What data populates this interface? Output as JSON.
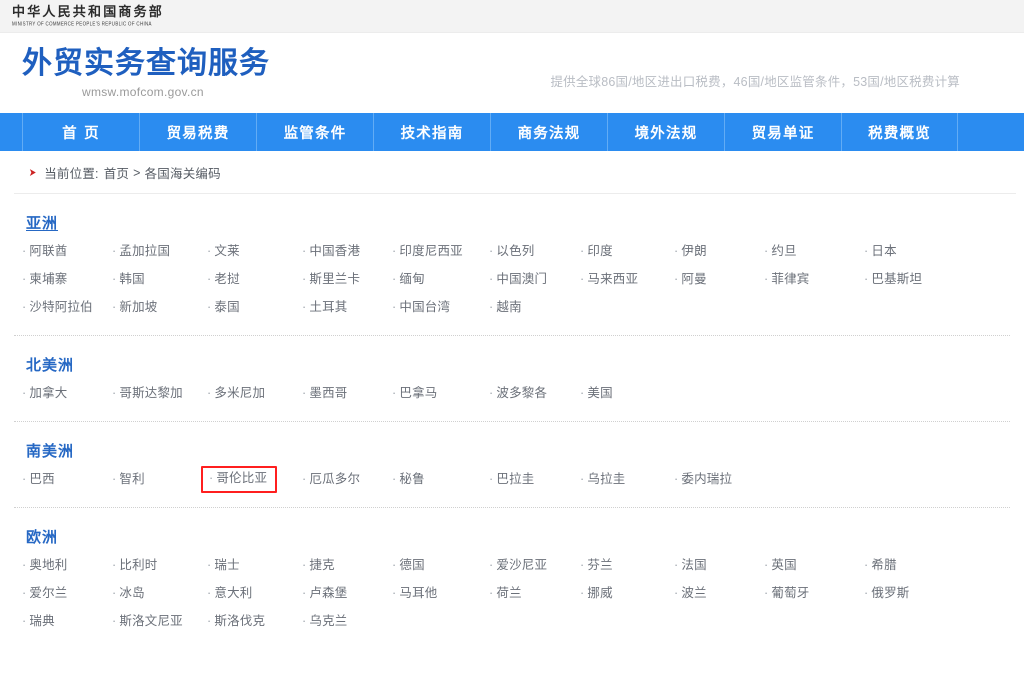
{
  "ministry": {
    "name_cn": "中华人民共和国商务部",
    "name_en": "MINISTRY OF COMMERCE PEOPLE'S REPUBLIC OF CHINA"
  },
  "hero": {
    "title": "外贸实务查询服务",
    "url": "wmsw.mofcom.gov.cn",
    "tagline": "提供全球86国/地区进出口税费，46国/地区监管条件，53国/地区税费计算"
  },
  "nav": {
    "items": [
      {
        "label": "首 页"
      },
      {
        "label": "贸易税费"
      },
      {
        "label": "监管条件"
      },
      {
        "label": "技术指南"
      },
      {
        "label": "商务法规"
      },
      {
        "label": "境外法规"
      },
      {
        "label": "贸易单证"
      },
      {
        "label": "税费概览"
      }
    ]
  },
  "breadcrumb": {
    "prefix": "当前位置:",
    "home": "首页",
    "separator": ">",
    "current": "各国海关编码"
  },
  "sections": [
    {
      "title": "亚洲",
      "title_underlined": true,
      "countries": [
        "阿联酋",
        "孟加拉国",
        "文莱",
        "中国香港",
        "印度尼西亚",
        "以色列",
        "印度",
        "伊朗",
        "约旦",
        "日本",
        "柬埔寨",
        "韩国",
        "老挝",
        "斯里兰卡",
        "缅甸",
        "中国澳门",
        "马来西亚",
        "阿曼",
        "菲律宾",
        "巴基斯坦",
        "沙特阿拉伯",
        "新加坡",
        "泰国",
        "土耳其",
        "中国台湾",
        "越南"
      ]
    },
    {
      "title": "北美洲",
      "title_underlined": false,
      "countries": [
        "加拿大",
        "哥斯达黎加",
        "多米尼加",
        "墨西哥",
        "巴拿马",
        "波多黎各",
        "美国"
      ]
    },
    {
      "title": "南美洲",
      "title_underlined": false,
      "highlighted": "哥伦比亚",
      "countries": [
        "巴西",
        "智利",
        "哥伦比亚",
        "厄瓜多尔",
        "秘鲁",
        "巴拉圭",
        "乌拉圭",
        "委内瑞拉"
      ]
    },
    {
      "title": "欧洲",
      "title_underlined": false,
      "countries": [
        "奥地利",
        "比利时",
        "瑞士",
        "捷克",
        "德国",
        "爱沙尼亚",
        "芬兰",
        "法国",
        "英国",
        "希腊",
        "爱尔兰",
        "冰岛",
        "意大利",
        "卢森堡",
        "马耳他",
        "荷兰",
        "挪威",
        "波兰",
        "葡萄牙",
        "俄罗斯",
        "瑞典",
        "斯洛文尼亚",
        "斯洛伐克",
        "乌克兰"
      ]
    }
  ],
  "colors": {
    "brand_blue": "#2b8cf0",
    "title_blue": "#1f5fbf",
    "section_blue": "#2668c4",
    "highlight_red": "#ff1f1f"
  }
}
